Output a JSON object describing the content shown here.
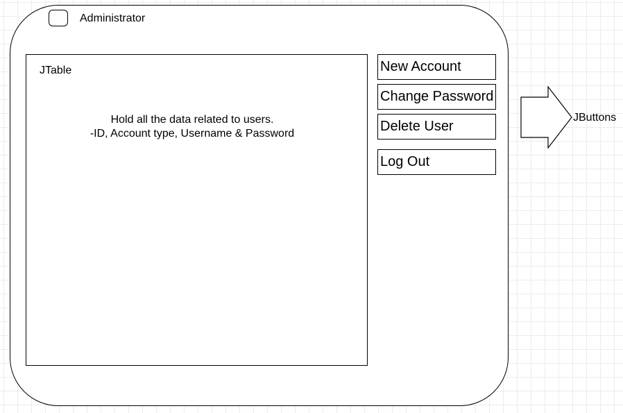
{
  "window": {
    "title": "Administrator"
  },
  "table": {
    "label": "JTable",
    "description_line1": "Hold all the data  related to users.",
    "description_line2": "-ID, Account type, Username & Password"
  },
  "buttons": [
    {
      "label": "New Account"
    },
    {
      "label": "Change Password"
    },
    {
      "label": "Delete User"
    },
    {
      "label": "Log Out"
    }
  ],
  "annotation": {
    "arrow_label": "JButtons"
  }
}
